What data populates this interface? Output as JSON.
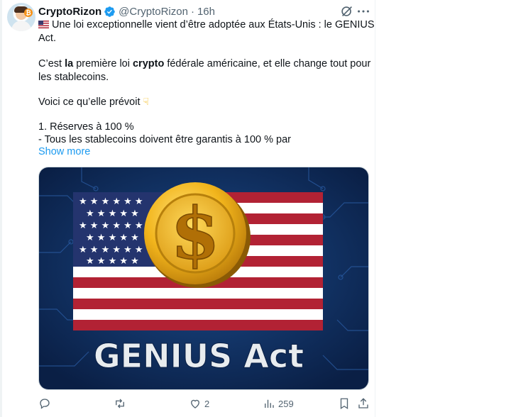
{
  "tweet": {
    "author_name": "CryptoRizon",
    "author_handle": "@CryptoRizon",
    "separator": "·",
    "time": "16h",
    "line1": "Une loi exceptionnelle vient d’être adoptée aux États-Unis : le GENIUS",
    "line2": "Act.",
    "p2_pre": "C’est ",
    "p2_bold1": "la",
    "p2_mid": " première loi ",
    "p2_bold2": "crypto",
    "p2_post": " fédérale américaine, et elle change tout pour",
    "p2_line2": "les stablecoins.",
    "p3": "Voici ce qu’elle prévoit",
    "p4_line1": "1. Réserves à 100 %",
    "p4_line2": "- Tous les stablecoins doivent être garantis à 100 % par",
    "show_more": "Show more"
  },
  "media": {
    "banner_text": "GENIUS Act",
    "coin_symbol": "$",
    "colors": {
      "background": "#0e2a57",
      "flag_red": "#b22234",
      "flag_blue": "#24346e",
      "coin_gold": "#f2b51c"
    }
  },
  "actions": {
    "reply_count": "",
    "retweet_count": "",
    "like_count": "2",
    "views_count": "259",
    "icons": [
      "reply-icon",
      "retweet-icon",
      "like-icon",
      "views-icon",
      "bookmark-icon",
      "share-icon"
    ]
  },
  "colors": {
    "accent": "#1d9bf0",
    "muted": "#536471",
    "text": "#0f1419"
  }
}
